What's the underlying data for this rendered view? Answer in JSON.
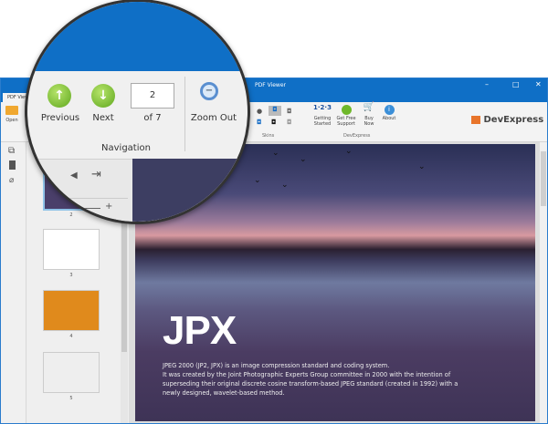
{
  "window": {
    "title": "PDF Viewer",
    "tab": "PDF Viewer"
  },
  "ribbon": {
    "open": "Open",
    "skins_group": "Skins",
    "devexpress_group": "DevExpress",
    "buttons": [
      {
        "label": "Getting Started",
        "icon": "123-icon"
      },
      {
        "label": "Get Free Support",
        "icon": "support-icon"
      },
      {
        "label": "Buy Now",
        "icon": "cart-icon"
      },
      {
        "label": "About",
        "icon": "info-icon"
      }
    ],
    "brand": "DevExpress"
  },
  "magnifier": {
    "previous": "Previous",
    "next": "Next",
    "page_value": "2",
    "of_pages": "of 7",
    "zoom_out": "Zoom Out",
    "group": "Navigation"
  },
  "thumbnails": [
    {
      "num": "2"
    },
    {
      "num": "3"
    },
    {
      "num": "4"
    },
    {
      "num": "5"
    }
  ],
  "document": {
    "heading": "JPX",
    "lines": [
      "JPEG 2000 (JP2, JPX) is an image compression standard and coding system.",
      "It was created by the Joint Photographic Experts Group committee in 2000 with the intention of",
      "superseding their original discrete cosine transform-based JPEG standard (created in 1992) with a",
      "newly designed, wavelet-based method."
    ]
  },
  "colors": {
    "titlebar": "#0f6fc6",
    "accent": "#e8742a"
  }
}
